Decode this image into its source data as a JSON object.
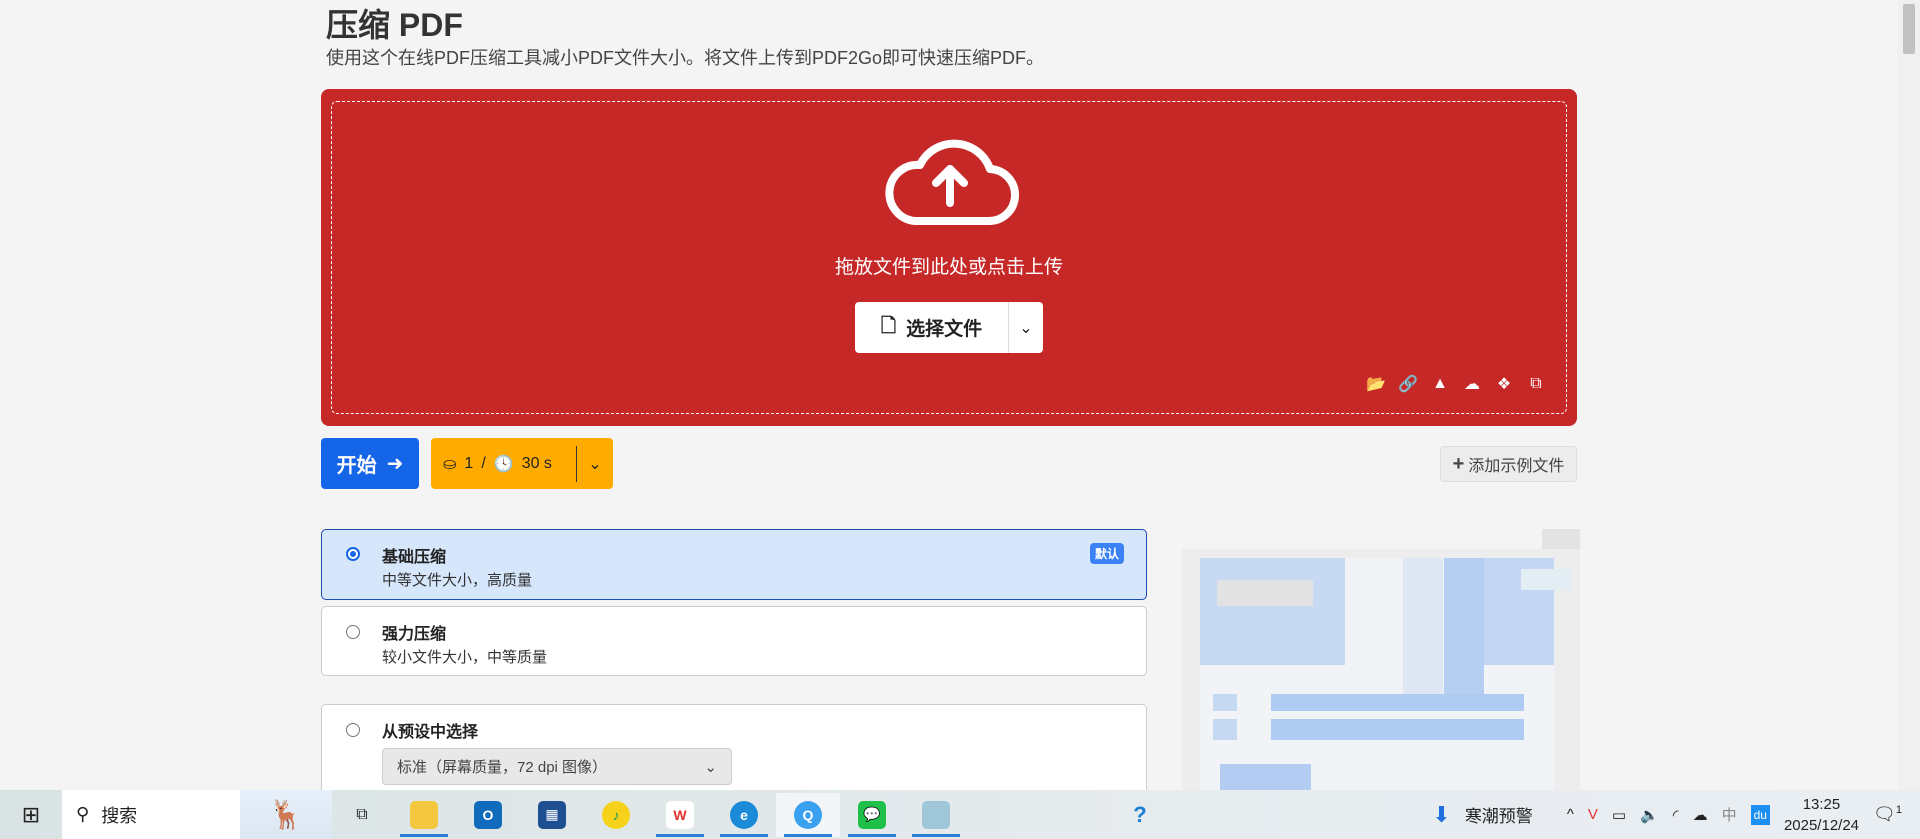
{
  "page": {
    "title": "压缩 PDF",
    "subtitle": "使用这个在线PDF压缩工具减小PDF文件大小。将文件上传到PDF2Go即可快速压缩PDF。"
  },
  "upload": {
    "drop_text": "拖放文件到此处或点击上传",
    "choose_label": "选择文件",
    "sources": [
      "folder-icon",
      "link-icon",
      "google-drive-icon",
      "onedrive-icon",
      "dropbox-icon",
      "clipboard-icon"
    ],
    "bg_color": "#c62828"
  },
  "actions": {
    "start_label": "开始",
    "credits": "1",
    "separator": "/",
    "time": "30 s",
    "add_example_label": "添加示例文件"
  },
  "options": [
    {
      "title": "基础压缩",
      "desc": "中等文件大小，高质量",
      "badge": "默认",
      "selected": true
    },
    {
      "title": "强力压缩",
      "desc": "较小文件大小，中等质量",
      "selected": false
    },
    {
      "title": "从预设中选择",
      "preset": "标准（屏幕质量，72 dpi 图像）",
      "selected": false
    }
  ],
  "taskbar": {
    "search_label": "搜索",
    "weather_label": "寒潮预警",
    "ime": "中",
    "time": "13:25",
    "date": "2025/12/24",
    "notifications": "1"
  }
}
